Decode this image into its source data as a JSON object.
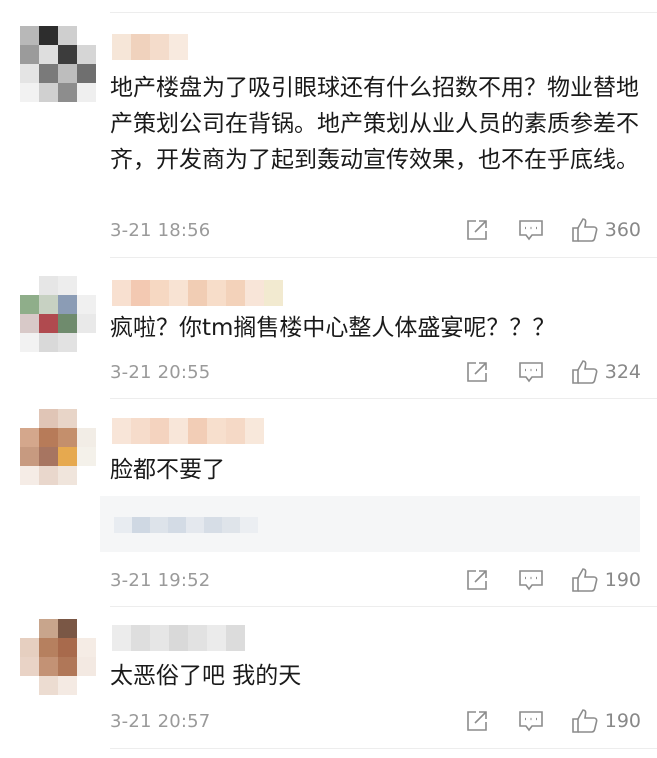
{
  "comments": [
    {
      "text": "地产楼盘为了吸引眼球还有什么招数不用？物业替地产策划公司在背锅。地产策划从业人员的素质参差不齐，开发商为了起到轰动宣传效果，也不在乎底线。",
      "time": "3-21 18:56",
      "likes": "360"
    },
    {
      "text": "疯啦？你tm搁售楼中心整人体盛宴呢？？？",
      "time": "3-21 20:55",
      "likes": "324"
    },
    {
      "text": "脸都不要了",
      "time": "3-21 19:52",
      "likes": "190"
    },
    {
      "text": "太恶俗了吧 我的天",
      "time": "3-21 20:57",
      "likes": "190"
    }
  ],
  "icons": {
    "share": "share-icon",
    "reply": "comment-icon",
    "like": "thumbs-up-icon",
    "avatar": "pixelated-avatar",
    "username": "pixelated-username"
  },
  "colors": {
    "text": "#1a1a1a",
    "meta": "#9a9a9a",
    "icon": "#8c8c8c",
    "divider": "#ededed",
    "reply_bg": "#f5f6f7"
  }
}
